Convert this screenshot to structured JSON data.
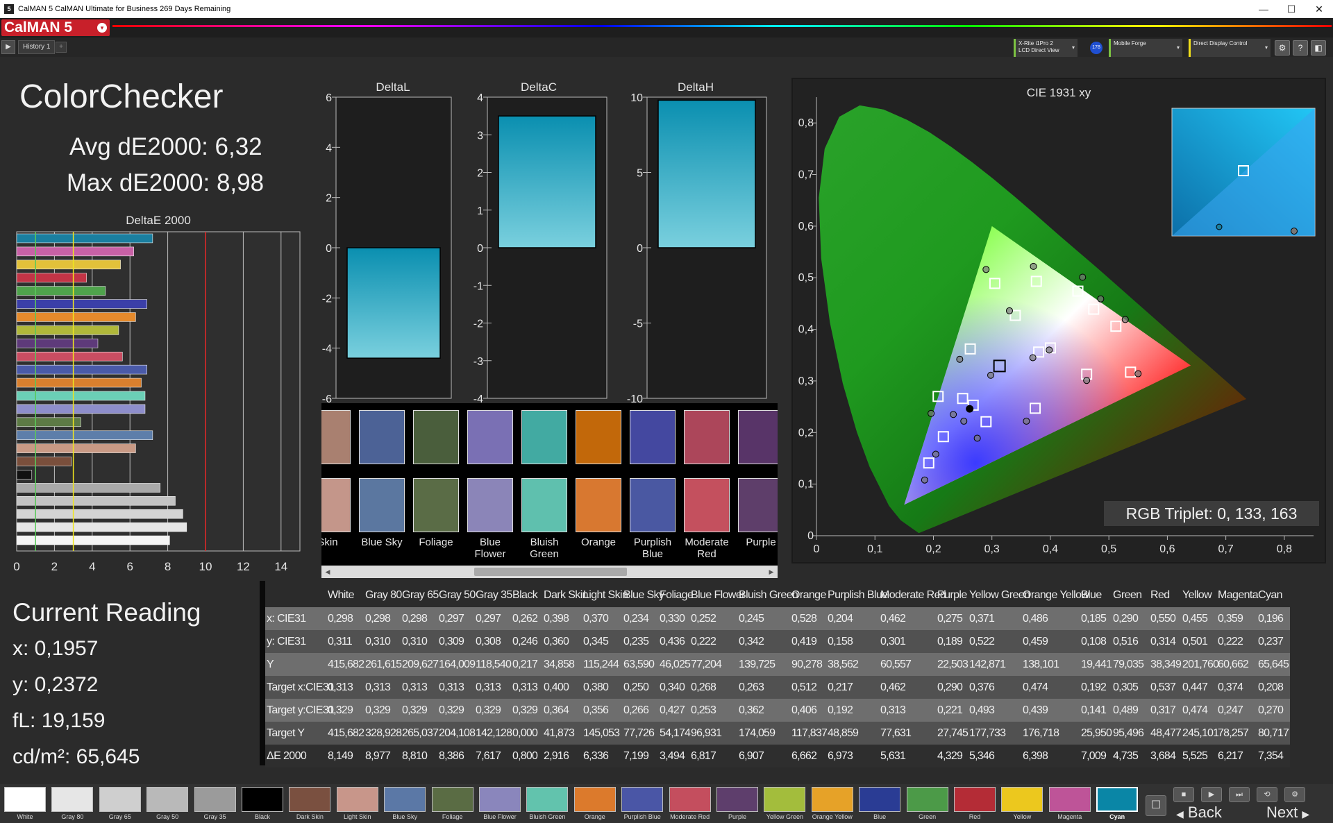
{
  "window": {
    "title": "CalMAN 5 CalMAN Ultimate for Business 269 Days Remaining",
    "app_icon": "5",
    "minimize": "—",
    "maximize": "☐",
    "close": "✕"
  },
  "brand": {
    "name": "CalMAN 5",
    "caret": "▾"
  },
  "toolbar": {
    "play": "▶",
    "tab": "History 1",
    "tab_add": "+",
    "devices": [
      {
        "line1": "X-Rite i1Pro 2",
        "line2": "LCD Direct View",
        "color": "#7cc242"
      },
      {
        "line1": "Mobile Forge",
        "line2": "",
        "color": "#7cc242"
      },
      {
        "line1": "Direct Display Control",
        "line2": "",
        "color": "#f2e01a"
      }
    ],
    "badge": "178",
    "dropdown": "▾",
    "gear_icon": "⚙",
    "help_icon": "?",
    "collapse_icon": "◧"
  },
  "colorchecker": {
    "title": "ColorChecker",
    "avg": "Avg dE2000: 6,32",
    "max": "Max dE2000: 8,98"
  },
  "deltae_chart": {
    "title": "DeltaE 2000",
    "x_ticks": [
      "0",
      "2",
      "4",
      "6",
      "8",
      "10",
      "12",
      "14"
    ],
    "xlim": [
      0,
      15
    ],
    "threshold_lines": [
      1,
      3,
      10
    ],
    "bars": [
      {
        "color": "#1a7fa0",
        "value": 7.2
      },
      {
        "color": "#c861a6",
        "value": 6.2
      },
      {
        "color": "#e2c13a",
        "value": 5.5
      },
      {
        "color": "#c23446",
        "value": 3.7
      },
      {
        "color": "#4fa34c",
        "value": 4.7
      },
      {
        "color": "#3b3fa8",
        "value": 6.9
      },
      {
        "color": "#e58a2c",
        "value": 6.3
      },
      {
        "color": "#b0b83a",
        "value": 5.4
      },
      {
        "color": "#5e3a7a",
        "value": 4.3
      },
      {
        "color": "#c94d62",
        "value": 5.6
      },
      {
        "color": "#4a5aa8",
        "value": 6.9
      },
      {
        "color": "#d9802e",
        "value": 6.6
      },
      {
        "color": "#6bcfb6",
        "value": 6.8
      },
      {
        "color": "#8e8ecb",
        "value": 6.8
      },
      {
        "color": "#5d7a45",
        "value": 3.4
      },
      {
        "color": "#5d7eaa",
        "value": 7.2
      },
      {
        "color": "#c99a85",
        "value": 6.3
      },
      {
        "color": "#7a4f3c",
        "value": 2.9
      },
      {
        "color": "#111111",
        "value": 0.8
      },
      {
        "color": "#a9a9a9",
        "value": 7.6
      },
      {
        "color": "#c3c3c3",
        "value": 8.4
      },
      {
        "color": "#d4d4d4",
        "value": 8.8
      },
      {
        "color": "#e6e6e6",
        "value": 9.0
      },
      {
        "color": "#f5f5f5",
        "value": 8.1
      }
    ]
  },
  "delta_charts": [
    {
      "title": "DeltaL",
      "ylim": [
        -6,
        6
      ],
      "ticks": [
        "6",
        "4",
        "2",
        "0",
        "-2",
        "-4",
        "-6"
      ],
      "tick_values": [
        6,
        4,
        2,
        0,
        -2,
        -4,
        -6
      ],
      "value": -4.4
    },
    {
      "title": "DeltaC",
      "ylim": [
        -4,
        4
      ],
      "ticks": [
        "4",
        "3",
        "2",
        "1",
        "0",
        "-1",
        "-2",
        "-3",
        "-4"
      ],
      "tick_values": [
        4,
        3,
        2,
        1,
        0,
        -1,
        -2,
        -3,
        -4
      ],
      "value": 3.5
    },
    {
      "title": "DeltaH",
      "ylim": [
        -10,
        10
      ],
      "ticks": [
        "10",
        "5",
        "0",
        "-5",
        "-10"
      ],
      "tick_values": [
        10,
        5,
        0,
        -5,
        -10
      ],
      "value": 9.8
    }
  ],
  "swatches": [
    {
      "label": "Skin",
      "actual": "#a98070",
      "target": "#c4968a"
    },
    {
      "label": "Blue Sky",
      "actual": "#4c6296",
      "target": "#5b77a0"
    },
    {
      "label": "Foliage",
      "actual": "#4a5e3c",
      "target": "#5a6c46"
    },
    {
      "label": "Blue Flower",
      "actual": "#7a70b4",
      "target": "#8b85b8"
    },
    {
      "label": "Bluish Green",
      "actual": "#42aaa2",
      "target": "#5fc0ae"
    },
    {
      "label": "Orange",
      "actual": "#c2680a",
      "target": "#d87830"
    },
    {
      "label": "Purplish Blue",
      "actual": "#4448a0",
      "target": "#4a58a2"
    },
    {
      "label": "Moderate Red",
      "actual": "#ac465a",
      "target": "#c4505e"
    },
    {
      "label": "Purple",
      "actual": "#583468",
      "target": "#5e3e6a"
    }
  ],
  "cie": {
    "title": "CIE 1931 xy",
    "x_ticks": [
      "0",
      "0,1",
      "0,2",
      "0,3",
      "0,4",
      "0,5",
      "0,6",
      "0,7",
      "0,8"
    ],
    "y_ticks": [
      "0",
      "0,1",
      "0,2",
      "0,3",
      "0,4",
      "0,5",
      "0,6",
      "0,7",
      "0,8"
    ],
    "xlim": [
      0,
      0.85
    ],
    "ylim": [
      0,
      0.85
    ],
    "targets": [
      [
        0.313,
        0.329
      ],
      [
        0.4,
        0.364
      ],
      [
        0.38,
        0.356
      ],
      [
        0.25,
        0.266
      ],
      [
        0.34,
        0.427
      ],
      [
        0.268,
        0.253
      ],
      [
        0.263,
        0.362
      ],
      [
        0.512,
        0.406
      ],
      [
        0.217,
        0.192
      ],
      [
        0.462,
        0.313
      ],
      [
        0.29,
        0.221
      ],
      [
        0.376,
        0.493
      ],
      [
        0.474,
        0.439
      ],
      [
        0.192,
        0.141
      ],
      [
        0.305,
        0.489
      ],
      [
        0.537,
        0.317
      ],
      [
        0.447,
        0.474
      ],
      [
        0.374,
        0.247
      ],
      [
        0.208,
        0.27
      ]
    ],
    "measured": [
      [
        0.298,
        0.311
      ],
      [
        0.262,
        0.246
      ],
      [
        0.398,
        0.36
      ],
      [
        0.37,
        0.345
      ],
      [
        0.234,
        0.235
      ],
      [
        0.33,
        0.436
      ],
      [
        0.252,
        0.222
      ],
      [
        0.245,
        0.342
      ],
      [
        0.528,
        0.419
      ],
      [
        0.204,
        0.158
      ],
      [
        0.462,
        0.301
      ],
      [
        0.275,
        0.189
      ],
      [
        0.371,
        0.522
      ],
      [
        0.486,
        0.459
      ],
      [
        0.185,
        0.108
      ],
      [
        0.29,
        0.516
      ],
      [
        0.55,
        0.314
      ],
      [
        0.455,
        0.501
      ],
      [
        0.359,
        0.222
      ],
      [
        0.196,
        0.237
      ]
    ],
    "rgb_triplet": "RGB Triplet: 0, 133, 163"
  },
  "current_reading": {
    "title": "Current Reading",
    "x": "x: 0,1957",
    "y": "y: 0,2372",
    "fl": "fL: 19,159",
    "cdm2": "cd/m²: 65,645"
  },
  "table": {
    "columns": [
      "White",
      "Gray 80",
      "Gray 65",
      "Gray 50",
      "Gray 35",
      "Black",
      "Dark Skin",
      "Light Skin",
      "Blue Sky",
      "Foliage",
      "Blue Flower",
      "Bluish Green",
      "Orange",
      "Purplish Blue",
      "Moderate Red",
      "Purple",
      "Yellow Green",
      "Orange Yellow",
      "Blue",
      "Green",
      "Red",
      "Yellow",
      "Magenta",
      "Cyan"
    ],
    "rows": [
      {
        "label": "x: CIE31",
        "values": [
          "0,298",
          "0,298",
          "0,298",
          "0,297",
          "0,297",
          "0,262",
          "0,398",
          "0,370",
          "0,234",
          "0,330",
          "0,252",
          "0,245",
          "0,528",
          "0,204",
          "0,462",
          "0,275",
          "0,371",
          "0,486",
          "0,185",
          "0,290",
          "0,550",
          "0,455",
          "0,359",
          "0,196"
        ]
      },
      {
        "label": "y: CIE31",
        "values": [
          "0,311",
          "0,310",
          "0,310",
          "0,309",
          "0,308",
          "0,246",
          "0,360",
          "0,345",
          "0,235",
          "0,436",
          "0,222",
          "0,342",
          "0,419",
          "0,158",
          "0,301",
          "0,189",
          "0,522",
          "0,459",
          "0,108",
          "0,516",
          "0,314",
          "0,501",
          "0,222",
          "0,237"
        ]
      },
      {
        "label": "Y",
        "values": [
          "415,682",
          "261,615",
          "209,627",
          "164,009",
          "118,540",
          "0,217",
          "34,858",
          "115,244",
          "63,590",
          "46,025",
          "77,204",
          "139,725",
          "90,278",
          "38,562",
          "60,557",
          "22,503",
          "142,871",
          "138,101",
          "19,441",
          "79,035",
          "38,349",
          "201,760",
          "60,662",
          "65,645"
        ]
      },
      {
        "label": "Target x:CIE31",
        "values": [
          "0,313",
          "0,313",
          "0,313",
          "0,313",
          "0,313",
          "0,313",
          "0,400",
          "0,380",
          "0,250",
          "0,340",
          "0,268",
          "0,263",
          "0,512",
          "0,217",
          "0,462",
          "0,290",
          "0,376",
          "0,474",
          "0,192",
          "0,305",
          "0,537",
          "0,447",
          "0,374",
          "0,208"
        ]
      },
      {
        "label": "Target y:CIE31",
        "values": [
          "0,329",
          "0,329",
          "0,329",
          "0,329",
          "0,329",
          "0,329",
          "0,364",
          "0,356",
          "0,266",
          "0,427",
          "0,253",
          "0,362",
          "0,406",
          "0,192",
          "0,313",
          "0,221",
          "0,493",
          "0,439",
          "0,141",
          "0,489",
          "0,317",
          "0,474",
          "0,247",
          "0,270"
        ]
      },
      {
        "label": "Target Y",
        "values": [
          "415,682",
          "328,928",
          "265,037",
          "204,108",
          "142,128",
          "0,000",
          "41,873",
          "145,053",
          "77,726",
          "54,174",
          "96,931",
          "174,059",
          "117,837",
          "48,859",
          "77,631",
          "27,745",
          "177,733",
          "176,718",
          "25,950",
          "95,496",
          "48,477",
          "245,101",
          "78,257",
          "80,717"
        ]
      },
      {
        "label": "ΔE 2000",
        "values": [
          "8,149",
          "8,977",
          "8,810",
          "8,386",
          "7,617",
          "0,800",
          "2,916",
          "6,336",
          "7,199",
          "3,494",
          "6,817",
          "6,907",
          "6,662",
          "6,973",
          "5,631",
          "4,329",
          "5,346",
          "6,398",
          "7,009",
          "4,735",
          "3,684",
          "5,525",
          "6,217",
          "7,354"
        ]
      }
    ]
  },
  "bottom_swatches": [
    {
      "label": "White",
      "color": "#ffffff"
    },
    {
      "label": "Gray 80",
      "color": "#e6e6e6"
    },
    {
      "label": "Gray 65",
      "color": "#cfcfcf"
    },
    {
      "label": "Gray 50",
      "color": "#b9b9b9"
    },
    {
      "label": "Gray 35",
      "color": "#9b9b9b"
    },
    {
      "label": "Black",
      "color": "#000000"
    },
    {
      "label": "Dark Skin",
      "color": "#7a5040"
    },
    {
      "label": "Light Skin",
      "color": "#c8968a"
    },
    {
      "label": "Blue Sky",
      "color": "#5b78a6"
    },
    {
      "label": "Foliage",
      "color": "#5a6c44"
    },
    {
      "label": "Blue Flower",
      "color": "#8a86bc"
    },
    {
      "label": "Bluish Green",
      "color": "#62c3ad"
    },
    {
      "label": "Orange",
      "color": "#dc7a2c"
    },
    {
      "label": "Purplish Blue",
      "color": "#4a56a6"
    },
    {
      "label": "Moderate Red",
      "color": "#c44e5e"
    },
    {
      "label": "Purple",
      "color": "#5e3e6c"
    },
    {
      "label": "Yellow Green",
      "color": "#a3bd3c"
    },
    {
      "label": "Orange Yellow",
      "color": "#e6a228"
    },
    {
      "label": "Blue",
      "color": "#2a3c94"
    },
    {
      "label": "Green",
      "color": "#4c9a48"
    },
    {
      "label": "Red",
      "color": "#b42c36"
    },
    {
      "label": "Yellow",
      "color": "#ecc81e"
    },
    {
      "label": "Magenta",
      "color": "#be5498"
    },
    {
      "label": "Cyan",
      "color": "#0a86a6"
    }
  ],
  "nav": {
    "back": "Back",
    "next": "Next",
    "back_icon": "◀",
    "next_icon": "▶"
  },
  "controls": [
    "■",
    "▶",
    "⏭",
    "⟲",
    "⚙",
    "☐"
  ]
}
